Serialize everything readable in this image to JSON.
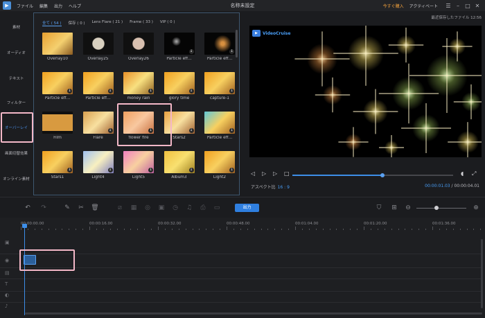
{
  "titlebar": {
    "menu": [
      "ファイル",
      "編集",
      "出力",
      "ヘルプ"
    ],
    "title": "名称未設定",
    "buy": "今すぐ購入",
    "activate": "アクティベート"
  },
  "sidebar": {
    "items": [
      "素材",
      "オーディオ",
      "テキスト",
      "フィルター",
      "オーバーレイ",
      "画面切替効果",
      "オンライン素材"
    ]
  },
  "library": {
    "tabs": [
      "全て ( 54 )",
      "保存 ( 0 )",
      "Lens Flare ( 21 )",
      "Frame ( 33 )",
      "VIP ( 0 )"
    ],
    "items": [
      {
        "label": "Overlay10",
        "download": false
      },
      {
        "label": "Overlay25",
        "download": false
      },
      {
        "label": "Overlay26",
        "download": false
      },
      {
        "label": "Particle eff...",
        "download": true
      },
      {
        "label": "Particle eff...",
        "download": true
      },
      {
        "label": "Particle eff...",
        "download": true
      },
      {
        "label": "Particle eff...",
        "download": true
      },
      {
        "label": "money rain",
        "download": true
      },
      {
        "label": "glory time",
        "download": true
      },
      {
        "label": "capture-1",
        "download": true
      },
      {
        "label": "Film",
        "download": false
      },
      {
        "label": "Flare",
        "download": true
      },
      {
        "label": "flower fire",
        "download": true
      },
      {
        "label": "Stars2",
        "download": true
      },
      {
        "label": "Particle eff...",
        "download": true
      },
      {
        "label": "Stars1",
        "download": true
      },
      {
        "label": "Light4",
        "download": true
      },
      {
        "label": "Light5",
        "download": true
      },
      {
        "label": "Album3",
        "download": true
      },
      {
        "label": "Light2",
        "download": true
      }
    ]
  },
  "preview": {
    "autosave": "最近保存したファイル 12:56",
    "watermark": "VideoCruise",
    "aspect_label": "アスペクト比",
    "aspect_value": "16 : 9",
    "current_time": "00:00:01.03",
    "separator": "/",
    "total_time": "00:00:04.01",
    "progress": 0.56
  },
  "toolbar": {
    "export_label": "出力",
    "zoom": 0.4
  },
  "timeline": {
    "ruler": [
      "00:00:00.00",
      "00:00:16.00",
      "00:00:32.00",
      "00:00:48.00",
      "00:01:04.00",
      "00:01:20.00",
      "00:01:36.00"
    ]
  },
  "colors": {
    "accent": "#3d8ee8",
    "buy": "#f0a03c",
    "highlight": "#f4b8c8"
  }
}
